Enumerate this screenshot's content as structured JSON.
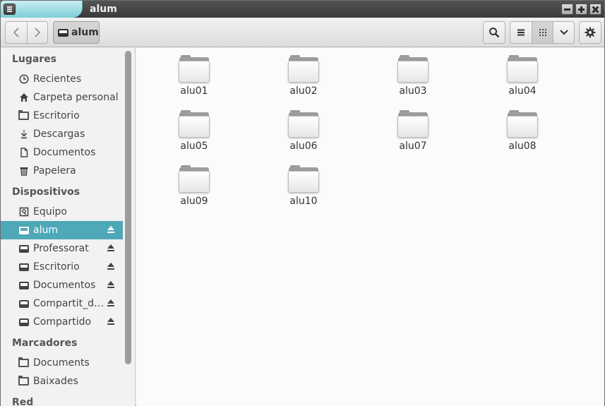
{
  "window": {
    "title": "alum"
  },
  "header": {
    "path_button": "alum"
  },
  "sidebar": {
    "sections": {
      "places": "Lugares",
      "devices": "Dispositivos",
      "bookmarks": "Marcadores",
      "network": "Red"
    },
    "places": [
      {
        "label": "Recientes",
        "icon": "clock-icon"
      },
      {
        "label": "Carpeta personal",
        "icon": "home-icon"
      },
      {
        "label": "Escritorio",
        "icon": "folder-icon"
      },
      {
        "label": "Descargas",
        "icon": "download-icon"
      },
      {
        "label": "Documentos",
        "icon": "document-icon"
      },
      {
        "label": "Papelera",
        "icon": "trash-icon"
      }
    ],
    "devices": [
      {
        "label": "Equipo",
        "icon": "computer-icon"
      },
      {
        "label": "alum",
        "icon": "drive-icon",
        "active": true
      },
      {
        "label": "Professorat",
        "icon": "drive-icon"
      },
      {
        "label": "Escritorio",
        "icon": "drive-icon"
      },
      {
        "label": "Documentos",
        "icon": "drive-icon"
      },
      {
        "label": "Compartit_d…",
        "icon": "drive-icon"
      },
      {
        "label": "Compartido",
        "icon": "drive-icon"
      }
    ],
    "bookmarks": [
      {
        "label": "Documents",
        "icon": "folder-icon"
      },
      {
        "label": "Baixades",
        "icon": "folder-icon"
      }
    ]
  },
  "files": [
    {
      "name": "alu01"
    },
    {
      "name": "alu02"
    },
    {
      "name": "alu03"
    },
    {
      "name": "alu04"
    },
    {
      "name": "alu05"
    },
    {
      "name": "alu06"
    },
    {
      "name": "alu07"
    },
    {
      "name": "alu08"
    },
    {
      "name": "alu09"
    },
    {
      "name": "alu10"
    }
  ],
  "colors": {
    "accent": "#4fa8b8",
    "titlebar": "#3f3f3f"
  }
}
